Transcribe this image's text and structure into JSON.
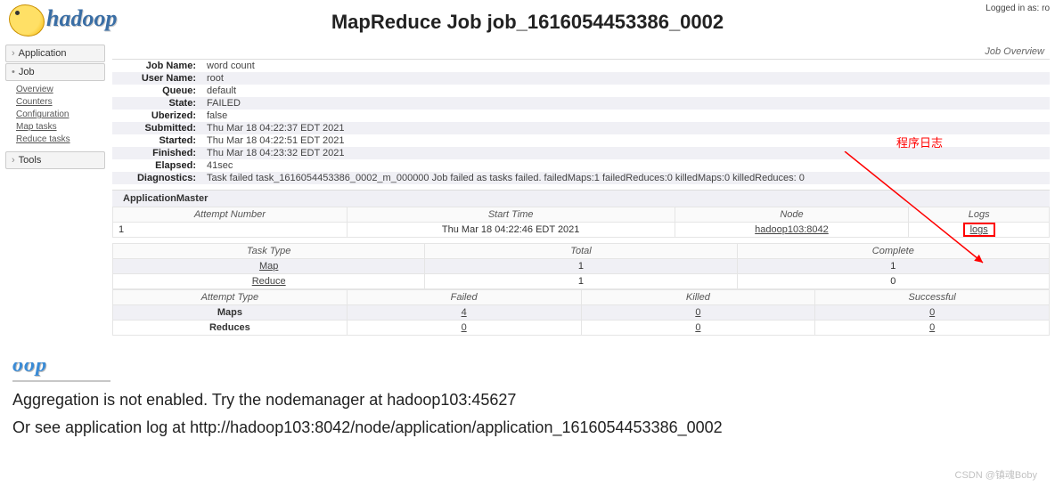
{
  "login_text": "Logged in as: ro",
  "page_title": "MapReduce Job job_1616054453386_0002",
  "sidebar": {
    "application": "Application",
    "job": "Job",
    "links": {
      "overview": "Overview",
      "counters": "Counters",
      "configuration": "Configuration",
      "map_tasks": "Map tasks",
      "reduce_tasks": "Reduce tasks"
    },
    "tools": "Tools"
  },
  "overview_title": "Job Overview",
  "kv": {
    "job_name_k": "Job Name:",
    "job_name_v": "word count",
    "user_name_k": "User Name:",
    "user_name_v": "root",
    "queue_k": "Queue:",
    "queue_v": "default",
    "state_k": "State:",
    "state_v": "FAILED",
    "uberized_k": "Uberized:",
    "uberized_v": "false",
    "submitted_k": "Submitted:",
    "submitted_v": "Thu Mar 18 04:22:37 EDT 2021",
    "started_k": "Started:",
    "started_v": "Thu Mar 18 04:22:51 EDT 2021",
    "finished_k": "Finished:",
    "finished_v": "Thu Mar 18 04:23:32 EDT 2021",
    "elapsed_k": "Elapsed:",
    "elapsed_v": "41sec",
    "diag_k": "Diagnostics:",
    "diag_v": "Task failed task_1616054453386_0002_m_000000 Job failed as tasks failed. failedMaps:1 failedReduces:0 killedMaps:0 killedReduces: 0"
  },
  "am": {
    "title": "ApplicationMaster",
    "h_attempt": "Attempt Number",
    "h_start": "Start Time",
    "h_node": "Node",
    "h_logs": "Logs",
    "row": {
      "attempt": "1",
      "start": "Thu Mar 18 04:22:46 EDT 2021",
      "node": "hadoop103:8042",
      "logs": "logs"
    }
  },
  "tasks": {
    "h_type": "Task Type",
    "h_total": "Total",
    "h_complete": "Complete",
    "map_label": "Map",
    "map_total": "1",
    "map_complete": "1",
    "reduce_label": "Reduce",
    "reduce_total": "1",
    "reduce_complete": "0"
  },
  "attempts": {
    "h_type": "Attempt Type",
    "h_failed": "Failed",
    "h_killed": "Killed",
    "h_success": "Successful",
    "maps_label": "Maps",
    "maps_failed": "4",
    "maps_killed": "0",
    "maps_success": "0",
    "reduces_label": "Reduces",
    "reduces_failed": "0",
    "reduces_killed": "0",
    "reduces_success": "0"
  },
  "annotation": "程序日志",
  "frag_logo": "oop",
  "frag_l1": "Aggregation is not enabled. Try the nodemanager at hadoop103:45627",
  "frag_l2": "Or see application log at http://hadoop103:8042/node/application/application_1616054453386_0002",
  "watermark": "CSDN @镇魂Boby"
}
